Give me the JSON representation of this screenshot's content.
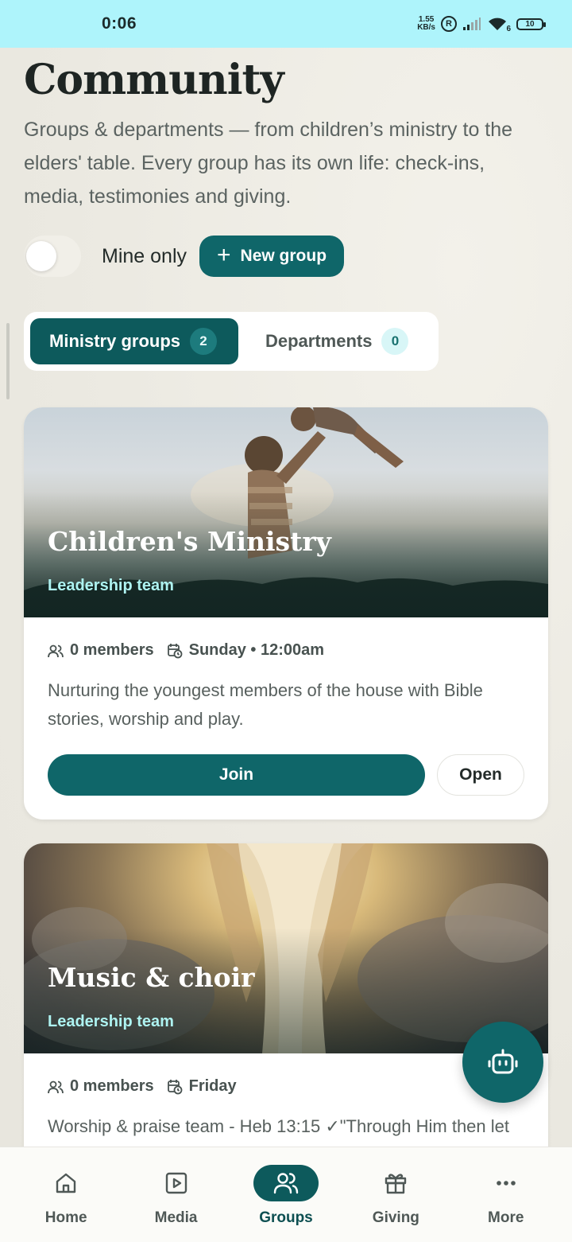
{
  "status_bar": {
    "time": "0:06",
    "net_speed_value": "1.55",
    "net_speed_unit": "KB/s",
    "badge": "R",
    "wifi_level": "6",
    "battery": "10"
  },
  "page": {
    "title": "Community",
    "subtitle": "Groups & departments — from children’s ministry to the elders' table. Every group has its own life: check-ins, media, testimonies and giving."
  },
  "controls": {
    "toggle_label": "Mine only",
    "toggle_on": false,
    "new_group_label": "New group"
  },
  "tabs": [
    {
      "label": "Ministry groups",
      "count": "2",
      "active": true
    },
    {
      "label": "Departments",
      "count": "0",
      "active": false
    }
  ],
  "groups": [
    {
      "name": "Children's Ministry",
      "role": "Leadership team",
      "members": "0 members",
      "schedule": "Sunday • 12:00am",
      "description": "Nurturing the youngest members of the house with Bible stories, worship and play.",
      "join_label": "Join",
      "open_label": "Open"
    },
    {
      "name": "Music & choir",
      "role": "Leadership team",
      "members": "0 members",
      "schedule": "Friday",
      "description": "Worship & praise team - Heb 13:15 ✓\"Through Him then let"
    }
  ],
  "bottom_nav": [
    {
      "label": "Home",
      "icon": "home-icon",
      "active": false
    },
    {
      "label": "Media",
      "icon": "play-icon",
      "active": false
    },
    {
      "label": "Groups",
      "icon": "users-icon",
      "active": true
    },
    {
      "label": "Giving",
      "icon": "gift-icon",
      "active": false
    },
    {
      "label": "More",
      "icon": "more-icon",
      "active": false
    }
  ],
  "colors": {
    "accent": "#0f6669",
    "accent_dark": "#0d5a5c",
    "status_bar": "#aef4fb",
    "hero_subtitle": "#aef3f1"
  }
}
